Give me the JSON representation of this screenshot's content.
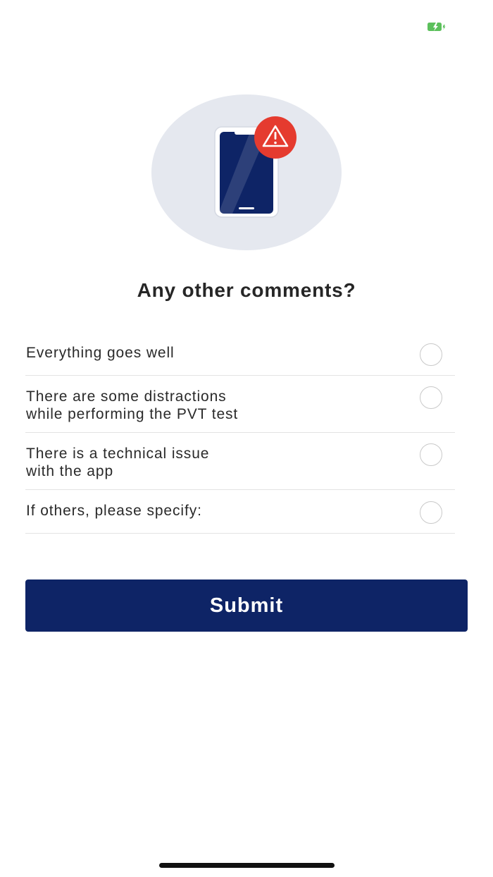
{
  "status_bar": {
    "battery_icon": "battery-charging-icon",
    "battery_color": "#5cc05c"
  },
  "hero": {
    "illustration": "phone-warning-illustration",
    "phone_color": "#0e2466",
    "warning_color": "#e53b2f",
    "circle_color": "#e5e8ef"
  },
  "page": {
    "title": "Any other comments?"
  },
  "options": [
    {
      "label": "Everything goes well",
      "selected": false
    },
    {
      "label": "There are some distractions\nwhile performing the PVT test",
      "selected": false
    },
    {
      "label": "There is a technical issue\nwith the app",
      "selected": false
    },
    {
      "label": "If others, please specify:",
      "selected": false
    }
  ],
  "actions": {
    "submit_label": "Submit",
    "submit_color": "#0e2466"
  }
}
